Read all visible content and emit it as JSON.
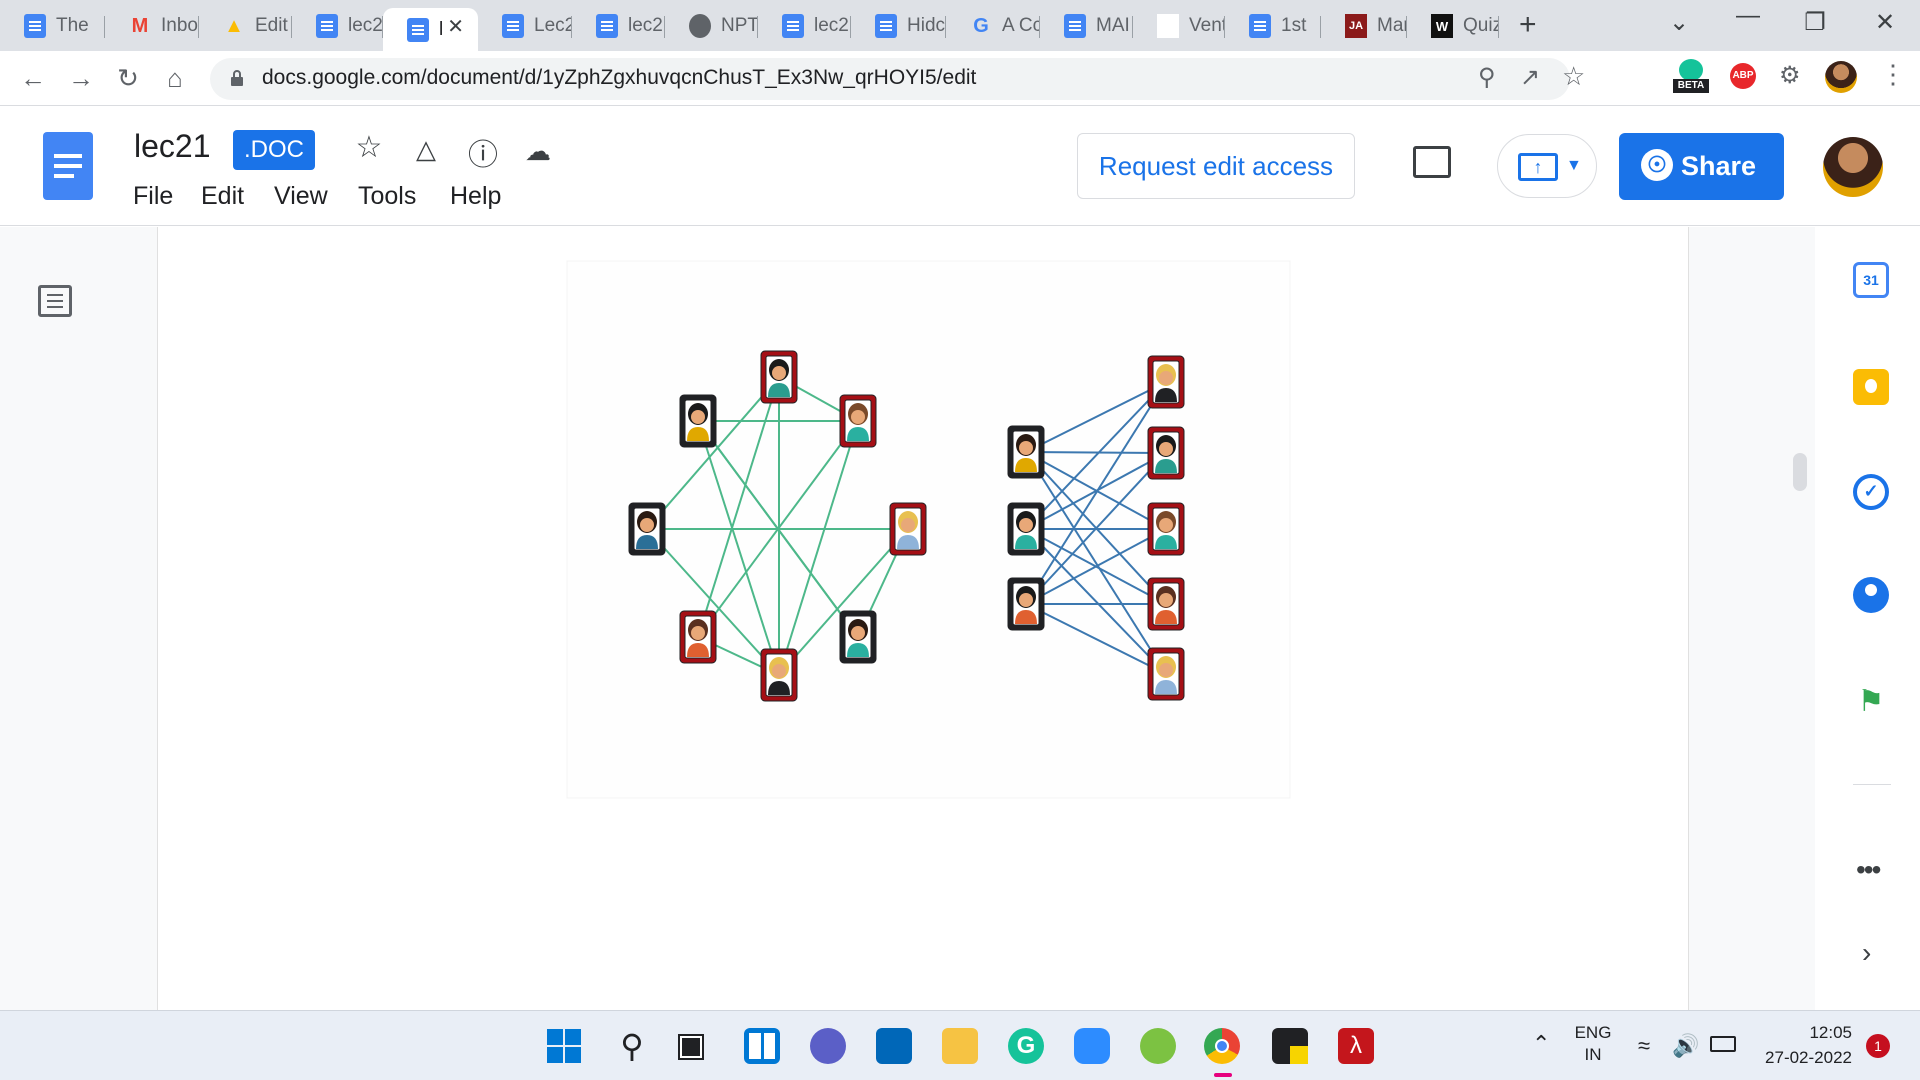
{
  "browser": {
    "tabs": [
      {
        "label": "The",
        "icon": "docs-icon"
      },
      {
        "label": "Inbo",
        "icon": "gmail-icon"
      },
      {
        "label": "Edit",
        "icon": "drive-icon"
      },
      {
        "label": "lec2",
        "icon": "docs-icon"
      },
      {
        "label": "l",
        "icon": "docs-icon",
        "active": true
      },
      {
        "label": "Lec2",
        "icon": "docs-icon"
      },
      {
        "label": "lec2",
        "icon": "docs-icon"
      },
      {
        "label": "NPT",
        "icon": "globe-icon"
      },
      {
        "label": "lec2",
        "icon": "docs-icon"
      },
      {
        "label": "Hidc",
        "icon": "docs-icon"
      },
      {
        "label": "A Cc",
        "icon": "google-icon"
      },
      {
        "label": "MAI",
        "icon": "docs-icon"
      },
      {
        "label": "Vent",
        "icon": "blank-icon"
      },
      {
        "label": "1st",
        "icon": "docs-icon"
      },
      {
        "label": "Mar",
        "icon": "ja-icon"
      },
      {
        "label": "Quiz",
        "icon": "w-icon"
      }
    ],
    "new_tab": "+",
    "url": "docs.google.com/document/d/1yZphZgxhuvqcnChusT_Ex3Nw_qrHOYI5/edit",
    "beta_label": "BETA",
    "abp_label": "ABP"
  },
  "docs": {
    "title": "lec21",
    "badge": ".DOC",
    "menu": [
      "File",
      "Edit",
      "View",
      "Tools",
      "Help"
    ],
    "request_edit": "Request edit access",
    "share": "Share"
  },
  "sidebar": {
    "icons": [
      "calendar-icon",
      "keep-icon",
      "tasks-icon",
      "contacts-icon",
      "maps-icon",
      "more-icon",
      "expand-icon"
    ],
    "calendar_day": "31"
  },
  "taskbar": {
    "lang_line1": "ENG",
    "lang_line2": "IN",
    "time": "12:05",
    "date": "27-02-2022",
    "notification_count": "1"
  },
  "figure": {
    "graph_left_nodes": [
      {
        "id": "L0",
        "frame": "#a50f15",
        "hair": "#1a1a1a",
        "shirt": "#2a9d8f"
      },
      {
        "id": "L1",
        "frame": "#202124",
        "hair": "#1a1a1a",
        "shirt": "#e0a800"
      },
      {
        "id": "L2",
        "frame": "#a50f15",
        "hair": "#7a4a2a",
        "shirt": "#2ab0a0"
      },
      {
        "id": "L3",
        "frame": "#202124",
        "hair": "#2a1a12",
        "shirt": "#2a6f97"
      },
      {
        "id": "L4",
        "frame": "#a50f15",
        "hair": "#e8c050",
        "shirt": "#8fb3d9"
      },
      {
        "id": "L5",
        "frame": "#a50f15",
        "hair": "#5a3020",
        "shirt": "#e06030"
      },
      {
        "id": "L6",
        "frame": "#202124",
        "hair": "#2a1a12",
        "shirt": "#2ab0a0"
      },
      {
        "id": "L7",
        "frame": "#a50f15",
        "hair": "#e8c050",
        "shirt": "#202124"
      }
    ],
    "graph_left_edges": [
      [
        0,
        2
      ],
      [
        0,
        3
      ],
      [
        0,
        5
      ],
      [
        0,
        7
      ],
      [
        1,
        2
      ],
      [
        1,
        6
      ],
      [
        1,
        7
      ],
      [
        2,
        5
      ],
      [
        2,
        7
      ],
      [
        3,
        4
      ],
      [
        3,
        7
      ],
      [
        4,
        6
      ],
      [
        4,
        7
      ],
      [
        5,
        7
      ],
      [
        6,
        1
      ]
    ],
    "bipartite_left": [
      {
        "id": "A",
        "frame": "#202124",
        "hair": "#2a1a12",
        "shirt": "#e0a800"
      },
      {
        "id": "B",
        "frame": "#202124",
        "hair": "#1a1a1a",
        "shirt": "#2ab0a0"
      },
      {
        "id": "C",
        "frame": "#202124",
        "hair": "#1a1a1a",
        "shirt": "#e06030"
      }
    ],
    "bipartite_right": [
      {
        "id": "P",
        "frame": "#a50f15",
        "hair": "#e8c050",
        "shirt": "#202124"
      },
      {
        "id": "Q",
        "frame": "#a50f15",
        "hair": "#1a1a1a",
        "shirt": "#2a9d8f"
      },
      {
        "id": "R",
        "frame": "#a50f15",
        "hair": "#7a4a2a",
        "shirt": "#2ab0a0"
      },
      {
        "id": "S",
        "frame": "#a50f15",
        "hair": "#5a3020",
        "shirt": "#e06030"
      },
      {
        "id": "T",
        "frame": "#a50f15",
        "hair": "#e8c050",
        "shirt": "#8fb3d9"
      }
    ],
    "colors": {
      "left_edges": "#4db88a",
      "bipartite_edges": "#3c78b0"
    }
  }
}
